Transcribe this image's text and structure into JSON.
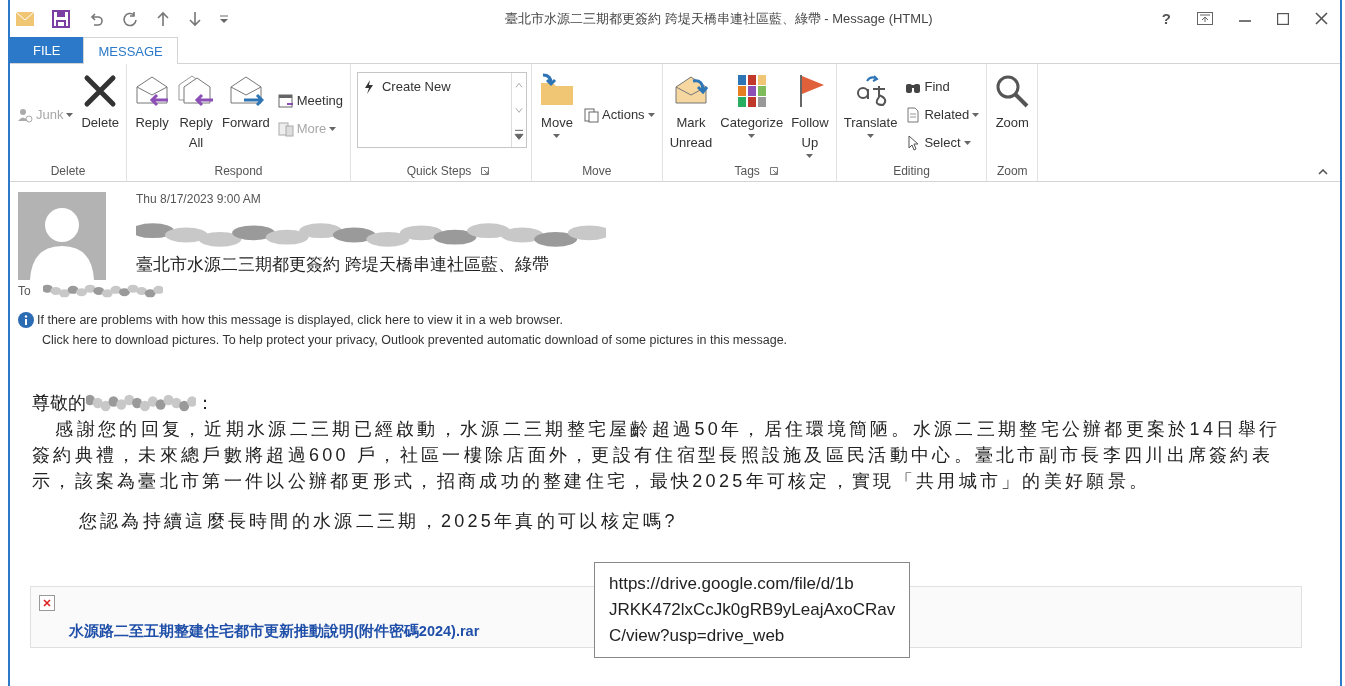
{
  "window": {
    "title": "臺北市水源二三期都更簽約 跨堤天橋串連社區藍、綠帶 - Message (HTML)",
    "help": "?"
  },
  "tabs": [
    {
      "label": "FILE",
      "selected": false,
      "kind": "file"
    },
    {
      "label": "MESSAGE",
      "selected": true,
      "kind": "tab"
    }
  ],
  "ribbon": {
    "groups": [
      {
        "label": "Delete",
        "columns": [
          {
            "kind": "stack",
            "buttons": [
              {
                "label": "Junk",
                "dropdown": true,
                "disabled": true
              }
            ]
          },
          {
            "kind": "large",
            "lines": [
              "Delete"
            ],
            "dropdown": false,
            "disabled": false
          }
        ]
      },
      {
        "label": "Respond",
        "columns": [
          {
            "kind": "large",
            "lines": [
              "Reply"
            ],
            "dropdown": false,
            "disabled": false
          },
          {
            "kind": "large",
            "lines": [
              "Reply",
              "All"
            ],
            "dropdown": false,
            "disabled": false
          },
          {
            "kind": "large",
            "lines": [
              "Forward"
            ],
            "dropdown": false,
            "disabled": false
          },
          {
            "kind": "stack",
            "buttons": [
              {
                "label": "Meeting",
                "dropdown": false,
                "disabled": false
              },
              {
                "label": "More",
                "dropdown": true,
                "disabled": true
              }
            ]
          }
        ]
      },
      {
        "label": "Quick Steps",
        "launcher": true,
        "columns": [
          {
            "kind": "gallery",
            "items": [
              "Create New"
            ]
          }
        ]
      },
      {
        "label": "Move",
        "columns": [
          {
            "kind": "large",
            "lines": [
              "Move"
            ],
            "dropdown": true,
            "disabled": false
          },
          {
            "kind": "stack",
            "buttons": [
              {
                "label": "Actions",
                "dropdown": true,
                "disabled": false
              }
            ]
          }
        ]
      },
      {
        "label": "Tags",
        "launcher": true,
        "columns": [
          {
            "kind": "large",
            "lines": [
              "Mark",
              "Unread"
            ],
            "dropdown": false,
            "disabled": false
          },
          {
            "kind": "large",
            "lines": [
              "Categorize"
            ],
            "dropdown": true,
            "disabled": false
          },
          {
            "kind": "large",
            "lines": [
              "Follow",
              "Up"
            ],
            "dropdown": true,
            "disabled": false
          }
        ]
      },
      {
        "label": "Editing",
        "columns": [
          {
            "kind": "large",
            "lines": [
              "Translate"
            ],
            "dropdown": true,
            "disabled": false
          },
          {
            "kind": "stack",
            "buttons": [
              {
                "label": "Find",
                "dropdown": false,
                "disabled": false
              },
              {
                "label": "Related",
                "dropdown": true,
                "disabled": false
              },
              {
                "label": "Select",
                "dropdown": true,
                "disabled": false
              }
            ]
          }
        ]
      },
      {
        "label": "Zoom",
        "columns": [
          {
            "kind": "large",
            "lines": [
              "Zoom"
            ],
            "dropdown": false,
            "disabled": false
          }
        ]
      }
    ]
  },
  "message": {
    "date": "Thu 8/17/2023 9:00 AM",
    "subject": "臺北市水源二三期都更簽約 跨堤天橋串連社區藍、綠帶",
    "to_label": "To",
    "infobar": [
      "If there are problems with how this message is displayed, click here to view it in a web browser.",
      "Click here to download pictures. To help protect your privacy, Outlook prevented automatic download of some pictures in this message."
    ],
    "greeting_prefix": "尊敬的",
    "greeting_suffix": "：",
    "paragraph": "感謝您的回复，近期水源二三期已經啟動，水源二三期整宅屋齡超過50年，居住環境簡陋。水源二三期整宅公辦都更案於14日舉行簽約典禮，未來總戶數將超過600 戶，社區一樓除店面外，更設有住宿型長照設施及區民活動中心。臺北市副市長李四川出席簽約表示，該案為臺北市第一件以公辦都更形式，招商成功的整建住宅，最快2025年可核定，實現「共用城市」的美好願景。",
    "question": "您認為持續這麼長時間的水源二三期，2025年真的可以核定嗎?",
    "attachment": "水源路二至五期整建住宅都市更新推動說明(附件密碼2024).rar",
    "tooltip": [
      "https://drive.google.com/file/d/1b",
      "JRKK472lxCcJk0gRB9yLeajAxoCRav",
      "C/view?usp=drive_web"
    ]
  }
}
